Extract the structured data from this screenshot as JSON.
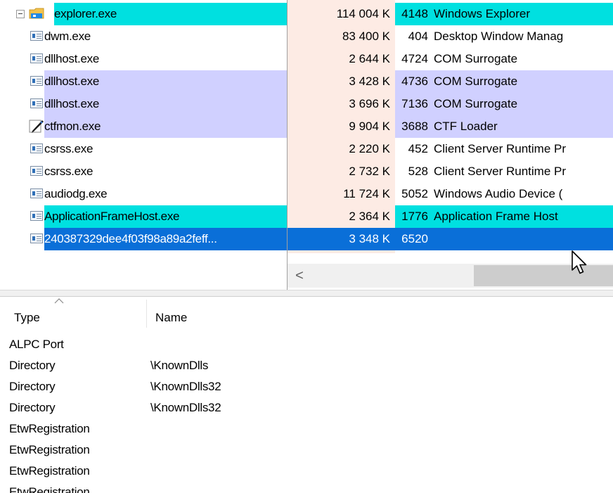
{
  "colors": {
    "highlight_cyan": "#00e0e0",
    "highlight_lavender": "#d0d0ff",
    "selection_blue": "#0a6fd8",
    "memory_column_bg": "#fdebe4"
  },
  "processes": [
    {
      "name": "explorer.exe",
      "memory": "114 004 K",
      "pid": "4148",
      "description": "Windows Explorer",
      "highlight": "cyan",
      "icon": "folder-icon",
      "expanded": true
    },
    {
      "name": "dwm.exe",
      "memory": "83 400 K",
      "pid": "404",
      "description": "Desktop Window Manag",
      "highlight": "none",
      "icon": "process-window-icon"
    },
    {
      "name": "dllhost.exe",
      "memory": "2 644 K",
      "pid": "4724",
      "description": "COM Surrogate",
      "highlight": "none",
      "icon": "process-window-icon"
    },
    {
      "name": "dllhost.exe",
      "memory": "3 428 K",
      "pid": "4736",
      "description": "COM Surrogate",
      "highlight": "lavender",
      "icon": "process-window-icon"
    },
    {
      "name": "dllhost.exe",
      "memory": "3 696 K",
      "pid": "7136",
      "description": "COM Surrogate",
      "highlight": "lavender",
      "icon": "process-window-icon"
    },
    {
      "name": "ctfmon.exe",
      "memory": "9 904 K",
      "pid": "3688",
      "description": "CTF Loader",
      "highlight": "lavender",
      "icon": "pen-icon"
    },
    {
      "name": "csrss.exe",
      "memory": "2 220 K",
      "pid": "452",
      "description": "Client Server Runtime Pr",
      "highlight": "none",
      "icon": "process-window-icon"
    },
    {
      "name": "csrss.exe",
      "memory": "2 732 K",
      "pid": "528",
      "description": "Client Server Runtime Pr",
      "highlight": "none",
      "icon": "process-window-icon"
    },
    {
      "name": "audiodg.exe",
      "memory": "11 724 K",
      "pid": "5052",
      "description": "Windows Audio Device (",
      "highlight": "none",
      "icon": "process-window-icon"
    },
    {
      "name": "ApplicationFrameHost.exe",
      "memory": "2 364 K",
      "pid": "1776",
      "description": "Application Frame Host",
      "highlight": "cyan",
      "icon": "process-window-icon"
    },
    {
      "name": "240387329dee4f03f98a89a2feff...",
      "memory": "3 348 K",
      "pid": "6520",
      "description": "",
      "highlight": "selected",
      "icon": "process-window-icon"
    }
  ],
  "scrollbar": {
    "left_arrow": "<"
  },
  "handles": {
    "columns": {
      "type": "Type",
      "name": "Name"
    },
    "sort_caret": "^",
    "rows": [
      {
        "type": "ALPC Port",
        "name": ""
      },
      {
        "type": "Directory",
        "name": "\\KnownDlls"
      },
      {
        "type": "Directory",
        "name": "\\KnownDlls32"
      },
      {
        "type": "Directory",
        "name": "\\KnownDlls32"
      },
      {
        "type": "EtwRegistration",
        "name": ""
      },
      {
        "type": "EtwRegistration",
        "name": ""
      },
      {
        "type": "EtwRegistration",
        "name": ""
      },
      {
        "type": "EtwRegistration",
        "name": ""
      }
    ]
  }
}
